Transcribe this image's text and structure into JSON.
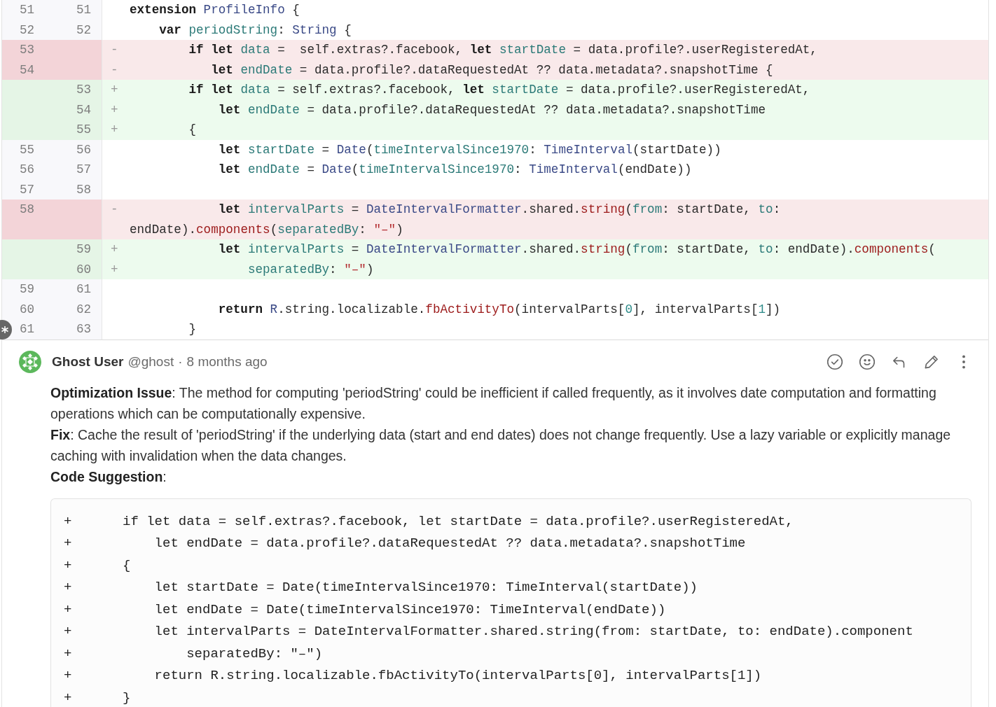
{
  "diff": {
    "rows": [
      {
        "kind": "context",
        "old": "51",
        "new": "51",
        "lines": [
          [
            {
              "kind": "keyword",
              "text": "extension "
            },
            {
              "kind": "type",
              "text": "ProfileInfo"
            },
            {
              "kind": "plain",
              "text": " {"
            }
          ]
        ]
      },
      {
        "kind": "context",
        "old": "52",
        "new": "52",
        "lines": [
          [
            {
              "kind": "keyword",
              "text": "    var "
            },
            {
              "kind": "name",
              "text": "periodString"
            },
            {
              "kind": "plain",
              "text": ": "
            },
            {
              "kind": "type",
              "text": "String"
            },
            {
              "kind": "plain",
              "text": " {"
            }
          ]
        ]
      },
      {
        "kind": "removed",
        "old": "53",
        "sign": "-",
        "lines": [
          [
            {
              "kind": "keyword",
              "text": "        if let "
            },
            {
              "kind": "name",
              "text": "data"
            },
            {
              "kind": "plain",
              "text": " =  self.extras?.facebook, "
            },
            {
              "kind": "keyword",
              "text": "let "
            },
            {
              "kind": "name",
              "text": "startDate"
            },
            {
              "kind": "plain",
              "text": " = data.profile?.userRegisteredAt,"
            }
          ]
        ]
      },
      {
        "kind": "removed",
        "old": "54",
        "sign": "-",
        "lines": [
          [
            {
              "kind": "keyword",
              "text": "           let "
            },
            {
              "kind": "name",
              "text": "endDate"
            },
            {
              "kind": "plain",
              "text": " = data.profile?.dataRequestedAt ?? data.metadata?.snapshotTime {"
            }
          ]
        ]
      },
      {
        "kind": "added",
        "new": "53",
        "sign": "+",
        "lines": [
          [
            {
              "kind": "keyword",
              "text": "        if let "
            },
            {
              "kind": "name",
              "text": "data"
            },
            {
              "kind": "plain",
              "text": " = self.extras?.facebook, "
            },
            {
              "kind": "keyword",
              "text": "let "
            },
            {
              "kind": "name",
              "text": "startDate"
            },
            {
              "kind": "plain",
              "text": " = data.profile?.userRegisteredAt,"
            }
          ]
        ]
      },
      {
        "kind": "added",
        "new": "54",
        "sign": "+",
        "lines": [
          [
            {
              "kind": "keyword",
              "text": "            let "
            },
            {
              "kind": "name",
              "text": "endDate"
            },
            {
              "kind": "plain",
              "text": " = data.profile?.dataRequestedAt ?? data.metadata?.snapshotTime"
            }
          ]
        ]
      },
      {
        "kind": "added",
        "new": "55",
        "sign": "+",
        "lines": [
          [
            {
              "kind": "plain",
              "text": "        {"
            }
          ]
        ]
      },
      {
        "kind": "context",
        "old": "55",
        "new": "56",
        "lines": [
          [
            {
              "kind": "keyword",
              "text": "            let "
            },
            {
              "kind": "name",
              "text": "startDate"
            },
            {
              "kind": "plain",
              "text": " = "
            },
            {
              "kind": "type",
              "text": "Date"
            },
            {
              "kind": "plain",
              "text": "("
            },
            {
              "kind": "name",
              "text": "timeIntervalSince1970"
            },
            {
              "kind": "plain",
              "text": ": "
            },
            {
              "kind": "type",
              "text": "TimeInterval"
            },
            {
              "kind": "plain",
              "text": "(startDate))"
            }
          ]
        ]
      },
      {
        "kind": "context",
        "old": "56",
        "new": "57",
        "lines": [
          [
            {
              "kind": "keyword",
              "text": "            let "
            },
            {
              "kind": "name",
              "text": "endDate"
            },
            {
              "kind": "plain",
              "text": " = "
            },
            {
              "kind": "type",
              "text": "Date"
            },
            {
              "kind": "plain",
              "text": "("
            },
            {
              "kind": "name",
              "text": "timeIntervalSince1970"
            },
            {
              "kind": "plain",
              "text": ": "
            },
            {
              "kind": "type",
              "text": "TimeInterval"
            },
            {
              "kind": "plain",
              "text": "(endDate))"
            }
          ]
        ]
      },
      {
        "kind": "context",
        "old": "57",
        "new": "58"
      },
      {
        "kind": "removed",
        "old": "58",
        "sign": "-",
        "lines": [
          [
            {
              "kind": "keyword",
              "text": "            let "
            },
            {
              "kind": "name",
              "text": "intervalParts"
            },
            {
              "kind": "plain",
              "text": " = "
            },
            {
              "kind": "type",
              "text": "DateIntervalFormatter"
            },
            {
              "kind": "plain",
              "text": ".shared."
            },
            {
              "kind": "function",
              "text": "string"
            },
            {
              "kind": "plain",
              "text": "("
            },
            {
              "kind": "name",
              "text": "from"
            },
            {
              "kind": "plain",
              "text": ": startDate, "
            },
            {
              "kind": "name",
              "text": "to"
            },
            {
              "kind": "plain",
              "text": ":"
            }
          ],
          [
            {
              "kind": "plain",
              "text": "endDate)."
            },
            {
              "kind": "function",
              "text": "components"
            },
            {
              "kind": "plain",
              "text": "("
            },
            {
              "kind": "name",
              "text": "separatedBy"
            },
            {
              "kind": "plain",
              "text": ": "
            },
            {
              "kind": "string",
              "text": "\"–\""
            },
            {
              "kind": "plain",
              "text": ")"
            }
          ]
        ]
      },
      {
        "kind": "added",
        "new": "59",
        "sign": "+",
        "lines": [
          [
            {
              "kind": "keyword",
              "text": "            let "
            },
            {
              "kind": "name",
              "text": "intervalParts"
            },
            {
              "kind": "plain",
              "text": " = "
            },
            {
              "kind": "type",
              "text": "DateIntervalFormatter"
            },
            {
              "kind": "plain",
              "text": ".shared."
            },
            {
              "kind": "function",
              "text": "string"
            },
            {
              "kind": "plain",
              "text": "("
            },
            {
              "kind": "name",
              "text": "from"
            },
            {
              "kind": "plain",
              "text": ": startDate, "
            },
            {
              "kind": "name",
              "text": "to"
            },
            {
              "kind": "plain",
              "text": ": endDate)."
            },
            {
              "kind": "function",
              "text": "components"
            },
            {
              "kind": "plain",
              "text": "("
            }
          ]
        ]
      },
      {
        "kind": "added",
        "new": "60",
        "sign": "+",
        "lines": [
          [
            {
              "kind": "name",
              "text": "                separatedBy"
            },
            {
              "kind": "plain",
              "text": ": "
            },
            {
              "kind": "string",
              "text": "\"–\""
            },
            {
              "kind": "plain",
              "text": ")"
            }
          ]
        ]
      },
      {
        "kind": "context",
        "old": "59",
        "new": "61"
      },
      {
        "kind": "context",
        "old": "60",
        "new": "62",
        "lines": [
          [
            {
              "kind": "keyword",
              "text": "            return "
            },
            {
              "kind": "type",
              "text": "R"
            },
            {
              "kind": "plain",
              "text": ".string.localizable."
            },
            {
              "kind": "function",
              "text": "fbActivityTo"
            },
            {
              "kind": "plain",
              "text": "(intervalParts["
            },
            {
              "kind": "number",
              "text": "0"
            },
            {
              "kind": "plain",
              "text": "], intervalParts["
            },
            {
              "kind": "number",
              "text": "1"
            },
            {
              "kind": "plain",
              "text": "])"
            }
          ]
        ]
      },
      {
        "kind": "context",
        "old": "61",
        "new": "63",
        "lines": [
          [
            {
              "kind": "plain",
              "text": "        }"
            }
          ]
        ]
      }
    ]
  },
  "comment": {
    "author": "Ghost User",
    "handle": "@ghost",
    "separator": "·",
    "time": "8 months ago",
    "paragraphs": [
      "**Optimization Issue**: The method for computing 'periodString' could be inefficient if called frequently, as it involves date computation and formatting operations which can be computationally expensive.",
      "**Fix**: Cache the result of 'periodString' if the underlying data (start and end dates) does not change frequently. Use a lazy variable or explicitly manage caching with invalidation when the data changes.",
      "**Code Suggestion**:"
    ],
    "suggestion": [
      {
        "sign": "+",
        "code": "if let data = self.extras?.facebook, let startDate = data.profile?.userRegisteredAt,"
      },
      {
        "sign": "+",
        "code": "    let endDate = data.profile?.dataRequestedAt ?? data.metadata?.snapshotTime"
      },
      {
        "sign": "+",
        "code": "{"
      },
      {
        "sign": "+",
        "code": "    let startDate = Date(timeIntervalSince1970: TimeInterval(startDate))"
      },
      {
        "sign": "+",
        "code": "    let endDate = Date(timeIntervalSince1970: TimeInterval(endDate))"
      },
      {
        "sign": "+",
        "code": "    let intervalParts = DateIntervalFormatter.shared.string(from: startDate, to: endDate).component"
      },
      {
        "sign": "+",
        "code": "        separatedBy: \"–\")"
      },
      {
        "sign": "+",
        "code": "    return R.string.localizable.fbActivityTo(intervalParts[0], intervalParts[1])"
      },
      {
        "sign": "+",
        "code": "}"
      }
    ]
  }
}
